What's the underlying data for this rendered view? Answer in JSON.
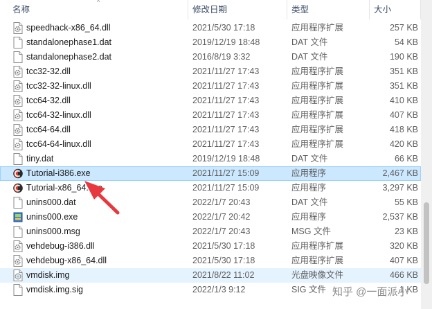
{
  "header": {
    "col_name": "名称",
    "col_date": "修改日期",
    "col_type": "类型",
    "col_size": "大小"
  },
  "files": [
    {
      "name": "speedhack-x86_64.dll",
      "date": "2021/5/30 17:18",
      "type": "应用程序扩展",
      "size": "257 KB",
      "icon": "dll-gear-icon"
    },
    {
      "name": "standalonephase1.dat",
      "date": "2019/12/19 18:48",
      "type": "DAT 文件",
      "size": "54 KB",
      "icon": "blank-file-icon"
    },
    {
      "name": "standalonephase2.dat",
      "date": "2016/8/19 3:32",
      "type": "DAT 文件",
      "size": "190 KB",
      "icon": "blank-file-icon"
    },
    {
      "name": "tcc32-32.dll",
      "date": "2021/11/27 17:43",
      "type": "应用程序扩展",
      "size": "351 KB",
      "icon": "dll-gear-icon"
    },
    {
      "name": "tcc32-32-linux.dll",
      "date": "2021/11/27 17:43",
      "type": "应用程序扩展",
      "size": "351 KB",
      "icon": "dll-gear-icon"
    },
    {
      "name": "tcc64-32.dll",
      "date": "2021/11/27 17:43",
      "type": "应用程序扩展",
      "size": "410 KB",
      "icon": "dll-gear-icon"
    },
    {
      "name": "tcc64-32-linux.dll",
      "date": "2021/11/27 17:43",
      "type": "应用程序扩展",
      "size": "407 KB",
      "icon": "dll-gear-icon"
    },
    {
      "name": "tcc64-64.dll",
      "date": "2021/11/27 17:43",
      "type": "应用程序扩展",
      "size": "418 KB",
      "icon": "dll-gear-icon"
    },
    {
      "name": "tcc64-64-linux.dll",
      "date": "2021/11/27 17:43",
      "type": "应用程序扩展",
      "size": "420 KB",
      "icon": "dll-gear-icon"
    },
    {
      "name": "tiny.dat",
      "date": "2019/12/19 18:48",
      "type": "DAT 文件",
      "size": "66 KB",
      "icon": "blank-file-icon"
    },
    {
      "name": "Tutorial-i386.exe",
      "date": "2021/11/27 15:09",
      "type": "应用程序",
      "size": "2,467 KB",
      "icon": "cheat-engine-icon"
    },
    {
      "name": "Tutorial-x86_64.exe",
      "date": "2021/11/27 15:09",
      "type": "应用程序",
      "size": "3,297 KB",
      "icon": "cheat-engine-icon"
    },
    {
      "name": "unins000.dat",
      "date": "2022/1/7 20:43",
      "type": "DAT 文件",
      "size": "55 KB",
      "icon": "blank-file-icon"
    },
    {
      "name": "unins000.exe",
      "date": "2022/1/7 20:42",
      "type": "应用程序",
      "size": "2,537 KB",
      "icon": "installer-icon"
    },
    {
      "name": "unins000.msg",
      "date": "2022/1/7 20:43",
      "type": "MSG 文件",
      "size": "23 KB",
      "icon": "blank-file-icon"
    },
    {
      "name": "vehdebug-i386.dll",
      "date": "2021/5/30 17:18",
      "type": "应用程序扩展",
      "size": "320 KB",
      "icon": "dll-gear-icon"
    },
    {
      "name": "vehdebug-x86_64.dll",
      "date": "2021/5/30 17:18",
      "type": "应用程序扩展",
      "size": "407 KB",
      "icon": "dll-gear-icon"
    },
    {
      "name": "vmdisk.img",
      "date": "2021/8/22 11:02",
      "type": "光盘映像文件",
      "size": "466 KB",
      "icon": "disc-image-icon"
    },
    {
      "name": "vmdisk.img.sig",
      "date": "2022/1/3 9:12",
      "type": "SIG 文件",
      "size": "1 KB",
      "icon": "blank-file-icon"
    }
  ],
  "selected_file": "Tutorial-i386.exe",
  "hovered_file": "vmdisk.img",
  "watermark": "知乎 @一面派小",
  "colors": {
    "selection": "#cce8ff",
    "hover": "#e5f3ff",
    "annotation_arrow": "#e8373f"
  }
}
